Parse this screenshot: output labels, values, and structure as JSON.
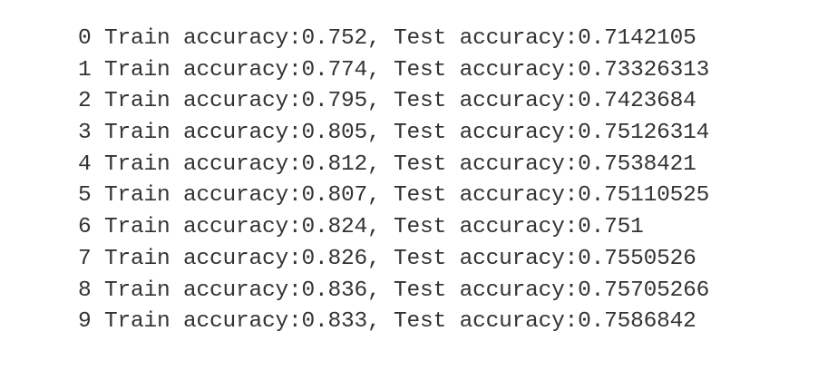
{
  "output": {
    "lines": [
      "0 Train accuracy:0.752, Test accuracy:0.7142105",
      "1 Train accuracy:0.774, Test accuracy:0.73326313",
      "2 Train accuracy:0.795, Test accuracy:0.7423684",
      "3 Train accuracy:0.805, Test accuracy:0.75126314",
      "4 Train accuracy:0.812, Test accuracy:0.7538421",
      "5 Train accuracy:0.807, Test accuracy:0.75110525",
      "6 Train accuracy:0.824, Test accuracy:0.751",
      "7 Train accuracy:0.826, Test accuracy:0.7550526",
      "8 Train accuracy:0.836, Test accuracy:0.75705266",
      "9 Train accuracy:0.833, Test accuracy:0.7586842"
    ]
  }
}
